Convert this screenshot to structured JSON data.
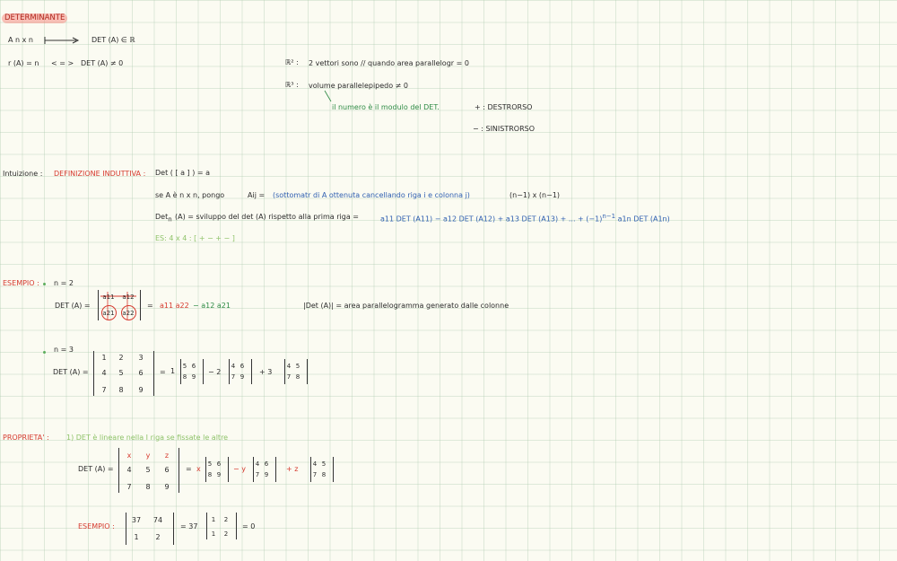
{
  "title": "DETERMINANTE",
  "row1": {
    "left": "A  n x n",
    "right": "DET (A) ∈ ℝ"
  },
  "row2": {
    "left": "r (A) = n",
    "mid": "< = >",
    "right": "DET (A) ≠ 0"
  },
  "r2_note": {
    "label": "ℝ² :",
    "text": "2 vettori sono // quando area parallelogr = 0"
  },
  "r3_note": {
    "label": "ℝ³ :",
    "text": "volume parallelepipedo ≠ 0"
  },
  "modulo_note": "il numero è il modulo del DET.",
  "destrorso": "+ : DESTRORSO",
  "sinistrorso": "− : SINISTRORSO",
  "intuition": {
    "label": "Intuizione :",
    "def_label": "DEFINIZIONE INDUTTIVA :",
    "line1": "Det ( [ a ] )  =  a",
    "line2_a": "se  A  è  n x n,  pongo",
    "line2_b": "Aij  =",
    "line2_c": "(sottomatr di A ottenuta cancellando riga i e colonna j)",
    "line2_d": "(n−1) x (n−1)",
    "line3_a": "Det",
    "line3_sub": "n",
    "line3_b": "(A)  =  sviluppo del det (A) rispetto alla prima riga  =",
    "line3_c": "a11 DET (A11)  −  a12 DET (A12)  +  a13 DET (A13)  +  ...  + (−1)",
    "line3_sup": "n−1",
    "line3_d": "a1n DET (A1n)",
    "es": "ES:   4 x 4   :   [ +  −  +  − ]"
  },
  "example": {
    "label": "ESEMPIO :",
    "n2": "n = 2",
    "det_a": "DET (A) =",
    "m2": [
      "a11",
      "a12",
      "a21",
      "a22"
    ],
    "formula_a": "=",
    "formula_b": "a11 a22",
    "formula_c": "− a12 a21",
    "area_note": "|Det (A)|  =  area  parallelogramma  generato  dalle  colonne",
    "n3": "n = 3",
    "det_a3": "DET (A) =",
    "m3": [
      "1",
      "2",
      "3",
      "4",
      "5",
      "6",
      "7",
      "8",
      "9"
    ],
    "eq": "=",
    "c1": "1",
    "m_56": [
      "5",
      "6",
      "8",
      "9"
    ],
    "minus2": "− 2",
    "m_46": [
      "4",
      "6",
      "7",
      "9"
    ],
    "plus3": "+ 3",
    "m_45": [
      "4",
      "5",
      "7",
      "8"
    ]
  },
  "properties": {
    "label": "PROPRIETA' :",
    "item1": "1)  DET  è  lineare  nella  I  riga  se  fissate  le  altre",
    "det_a": "DET (A) =",
    "m3": [
      "x",
      "y",
      "z",
      "4",
      "5",
      "6",
      "7",
      "8",
      "9"
    ],
    "eq": "=",
    "cx": "x",
    "m_56": [
      "5",
      "6",
      "8",
      "9"
    ],
    "my": "− y",
    "m_46": [
      "4",
      "6",
      "7",
      "9"
    ],
    "pz": "+ z",
    "m_45": [
      "4",
      "5",
      "7",
      "8"
    ],
    "ex_label": "ESEMPIO :",
    "ex_m": [
      "37",
      "74",
      "1",
      "2"
    ],
    "ex_eq": "= 37",
    "ex_m2": [
      "1",
      "2",
      "1",
      "2"
    ],
    "ex_res": "= 0"
  }
}
